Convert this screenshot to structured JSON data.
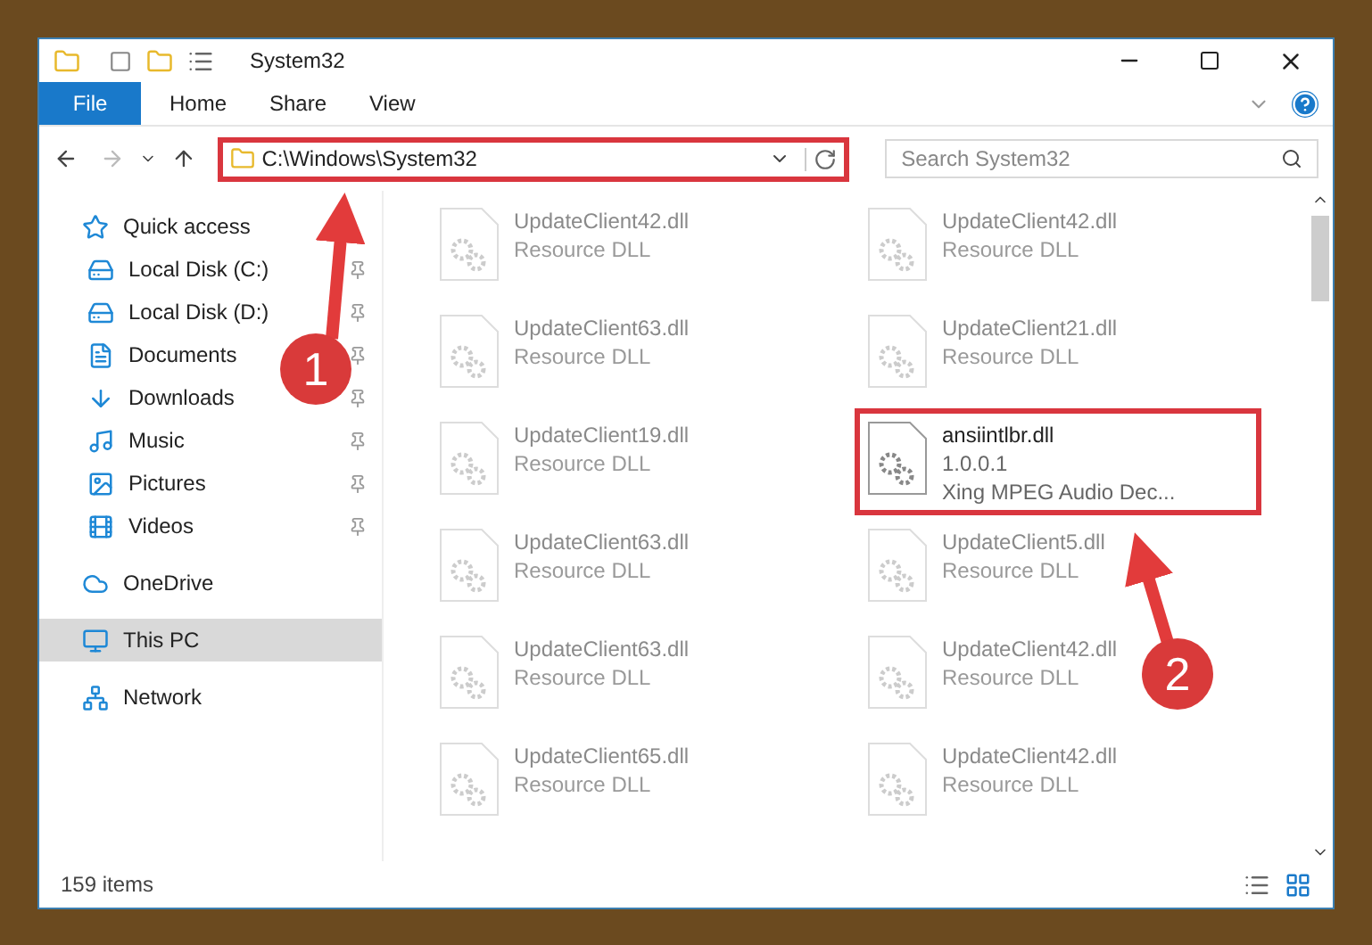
{
  "window": {
    "title": "System32"
  },
  "ribbon_tabs": [
    {
      "label": "File",
      "selected": true
    },
    {
      "label": "Home",
      "selected": false
    },
    {
      "label": "Share",
      "selected": false
    },
    {
      "label": "View",
      "selected": false
    }
  ],
  "address": {
    "value": "C:\\Windows\\System32",
    "highlighted": true
  },
  "search": {
    "placeholder": "Search System32"
  },
  "sidebar": {
    "items": [
      {
        "label": "Quick access",
        "kind": "star",
        "pinned": false,
        "selected": false,
        "children": [
          {
            "label": "Local Disk (C:)",
            "kind": "disk",
            "pinned": true,
            "selected": false
          },
          {
            "label": "Local Disk (D:)",
            "kind": "disk",
            "pinned": true,
            "selected": false
          },
          {
            "label": "Documents",
            "kind": "documents",
            "pinned": true,
            "selected": false
          },
          {
            "label": "Downloads",
            "kind": "downloads",
            "pinned": true,
            "selected": false
          },
          {
            "label": "Music",
            "kind": "music",
            "pinned": true,
            "selected": false
          },
          {
            "label": "Pictures",
            "kind": "pictures",
            "pinned": true,
            "selected": false
          },
          {
            "label": "Videos",
            "kind": "videos",
            "pinned": true,
            "selected": false
          }
        ]
      },
      {
        "label": "OneDrive",
        "kind": "cloud",
        "pinned": false,
        "selected": false
      },
      {
        "label": "This PC",
        "kind": "pc",
        "pinned": false,
        "selected": true
      },
      {
        "label": "Network",
        "kind": "network",
        "pinned": false,
        "selected": false
      }
    ]
  },
  "files": [
    {
      "name": "UpdateClient42.dll",
      "details": [
        "Resource DLL"
      ],
      "blurred": true,
      "highlighted": false
    },
    {
      "name": "UpdateClient42.dll",
      "details": [
        "Resource DLL"
      ],
      "blurred": true,
      "highlighted": false
    },
    {
      "name": "UpdateClient63.dll",
      "details": [
        "Resource DLL"
      ],
      "blurred": true,
      "highlighted": false
    },
    {
      "name": "UpdateClient21.dll",
      "details": [
        "Resource DLL"
      ],
      "blurred": true,
      "highlighted": false
    },
    {
      "name": "UpdateClient19.dll",
      "details": [
        "Resource DLL"
      ],
      "blurred": true,
      "highlighted": false
    },
    {
      "name": "ansiintlbr.dll",
      "details": [
        "1.0.0.1",
        "Xing MPEG Audio Dec..."
      ],
      "blurred": false,
      "highlighted": true
    },
    {
      "name": "UpdateClient63.dll",
      "details": [
        "Resource DLL"
      ],
      "blurred": true,
      "highlighted": false
    },
    {
      "name": "UpdateClient5.dll",
      "details": [
        "Resource DLL"
      ],
      "blurred": true,
      "highlighted": false
    },
    {
      "name": "UpdateClient63.dll",
      "details": [
        "Resource DLL"
      ],
      "blurred": true,
      "highlighted": false
    },
    {
      "name": "UpdateClient42.dll",
      "details": [
        "Resource DLL"
      ],
      "blurred": true,
      "highlighted": false
    },
    {
      "name": "UpdateClient65.dll",
      "details": [
        "Resource DLL"
      ],
      "blurred": true,
      "highlighted": false
    },
    {
      "name": "UpdateClient42.dll",
      "details": [
        "Resource DLL"
      ],
      "blurred": true,
      "highlighted": false
    }
  ],
  "status_bar": {
    "item_count": "159 items"
  },
  "callouts": [
    {
      "number": "1"
    },
    {
      "number": "2"
    }
  ]
}
